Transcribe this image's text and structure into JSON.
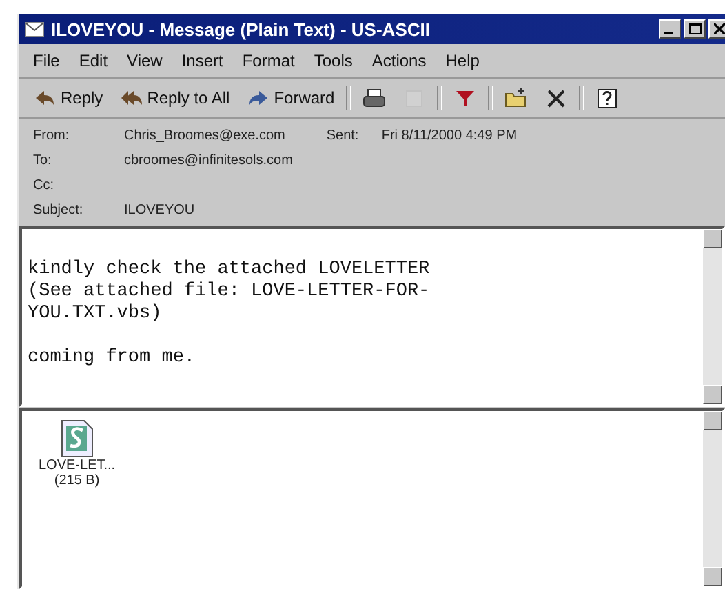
{
  "window": {
    "title": "ILOVEYOU - Message (Plain Text) - US-ASCII"
  },
  "menu": [
    {
      "label": "File"
    },
    {
      "label": "Edit"
    },
    {
      "label": "View"
    },
    {
      "label": "Insert"
    },
    {
      "label": "Format"
    },
    {
      "label": "Tools"
    },
    {
      "label": "Actions"
    },
    {
      "label": "Help"
    }
  ],
  "toolbar": [
    {
      "kind": "text",
      "label": "Reply"
    },
    {
      "kind": "text",
      "label": "Reply to All"
    },
    {
      "kind": "text",
      "label": "Forward"
    },
    {
      "kind": "sep"
    },
    {
      "kind": "icon",
      "disabled": false
    },
    {
      "kind": "icon",
      "disabled": true
    },
    {
      "kind": "sep"
    },
    {
      "kind": "icon",
      "disabled": false
    },
    {
      "kind": "sep"
    },
    {
      "kind": "icon",
      "disabled": false
    },
    {
      "kind": "icon",
      "disabled": false
    },
    {
      "kind": "sep"
    },
    {
      "kind": "icon",
      "disabled": false
    }
  ],
  "header": [
    [
      {
        "label": "From:",
        "value": "Chris_Broomes@exe.com"
      },
      {
        "label": "Sent:",
        "value": "Fri 8/11/2000 4:49 PM"
      }
    ],
    [
      {
        "label": "To:",
        "value": "cbroomes@infinitesols.com"
      }
    ],
    [
      {
        "label": "Cc:"
      }
    ],
    [
      {
        "label": "Subject:",
        "value": "ILOVEYOU"
      }
    ]
  ],
  "body": {
    "paragraphs": [
      [
        "kindly check the attached LOVELETTER",
        "(See attached file: LOVE-LETTER-FOR-",
        "YOU.TXT.vbs)"
      ],
      [
        "coming from me."
      ]
    ]
  },
  "attachments": [
    {
      "name": "LOVE-LET...",
      "size": "(215 B)"
    }
  ]
}
